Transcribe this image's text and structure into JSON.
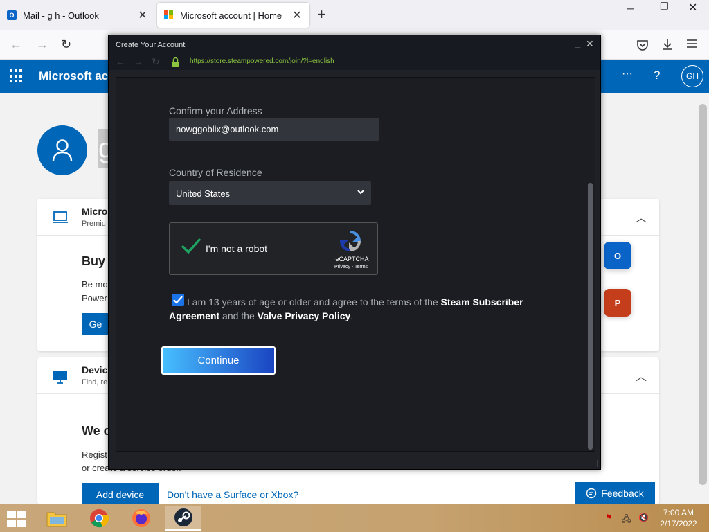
{
  "browser": {
    "tabs": [
      {
        "label": "Mail - g h - Outlook",
        "icon": "outlook-icon"
      },
      {
        "label": "Microsoft account | Home",
        "icon": "microsoft-logo-icon"
      }
    ],
    "new_tab_icon": "plus-icon"
  },
  "ms_page": {
    "header_title": "Microsoft account",
    "more_label": "···",
    "help_label": "?",
    "avatar_initials": "GH",
    "profile_name_fragment": "g",
    "card1": {
      "title": "Micro",
      "subtitle": "Premiu",
      "heading": "Buy M",
      "body_line1": "Be mo",
      "body_line2": "Power",
      "button_label": "Ge"
    },
    "card2": {
      "title": "Device",
      "subtitle": "Find, re",
      "heading": "We c",
      "body_line1": "Regist",
      "body_line2": "or create a service order.",
      "button_label": "Add device",
      "link_label": "Don't have a Surface or Xbox?"
    },
    "feedback_label": "Feedback"
  },
  "steam": {
    "window_title": "Create Your Account",
    "url": "https://store.steampowered.com/join/?l=english",
    "confirm_label": "Confirm your Address",
    "confirm_value": "nowggoblix@outlook.com",
    "country_label": "Country of Residence",
    "country_value": "United States",
    "captcha": {
      "text": "I'm not a robot",
      "brand": "reCAPTCHA",
      "terms": "Privacy - Terms",
      "checked": true
    },
    "agree": {
      "checked": true,
      "prefix": "I am 13 years of age or older and agree to the terms of the ",
      "link1": "Steam Subscriber Agreement",
      "middle": " and the ",
      "link2": "Valve Privacy Policy",
      "suffix": "."
    },
    "continue_label": "Continue"
  },
  "taskbar": {
    "apps": [
      "file-explorer-icon",
      "chrome-icon",
      "firefox-icon",
      "steam-icon"
    ],
    "time": "7:00 AM",
    "date": "2/17/2022"
  },
  "colors": {
    "ms_blue": "#0067b8",
    "steam_bg": "#1b1d22",
    "steam_url_green": "#8bc53f",
    "continue_start": "#47bfff",
    "continue_end": "#1a44c2"
  }
}
